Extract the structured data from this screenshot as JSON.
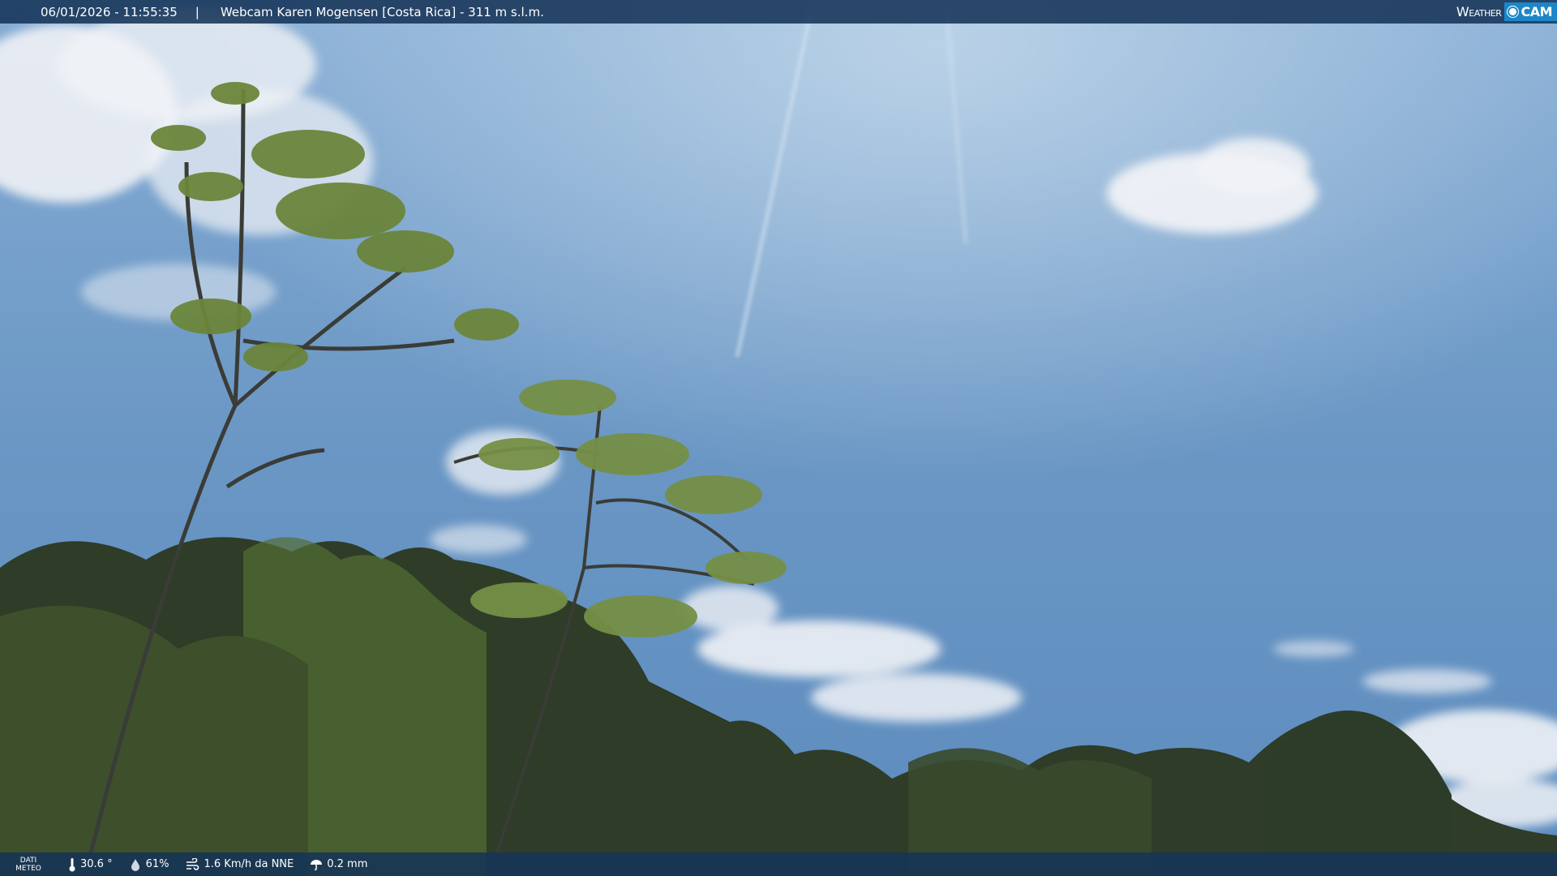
{
  "header": {
    "datetime": "06/01/2026 - 11:55:35",
    "separator": "|",
    "title": "Webcam Karen Mogensen [Costa Rica] - 311 m s.l.m.",
    "logo_weather": "Weather",
    "logo_cam": "CAM"
  },
  "footer": {
    "label_line1": "DATI",
    "label_line2": "METEO",
    "temperature": "30.6 °",
    "humidity": "61%",
    "wind": "1.6 Km/h da NNE",
    "rain": "0.2 mm"
  },
  "icons": {
    "temperature": "thermometer-icon",
    "humidity": "humidity-drop-icon",
    "wind": "wind-icon",
    "rain": "rain-gauge-icon"
  },
  "colors": {
    "bar": "#163458",
    "logo_accent": "#1d86c9",
    "sky_top": "#8fb6dc",
    "sky_bottom": "#5a8ec2",
    "foliage_dark": "#27301c",
    "foliage_light": "#7f9a3a"
  }
}
